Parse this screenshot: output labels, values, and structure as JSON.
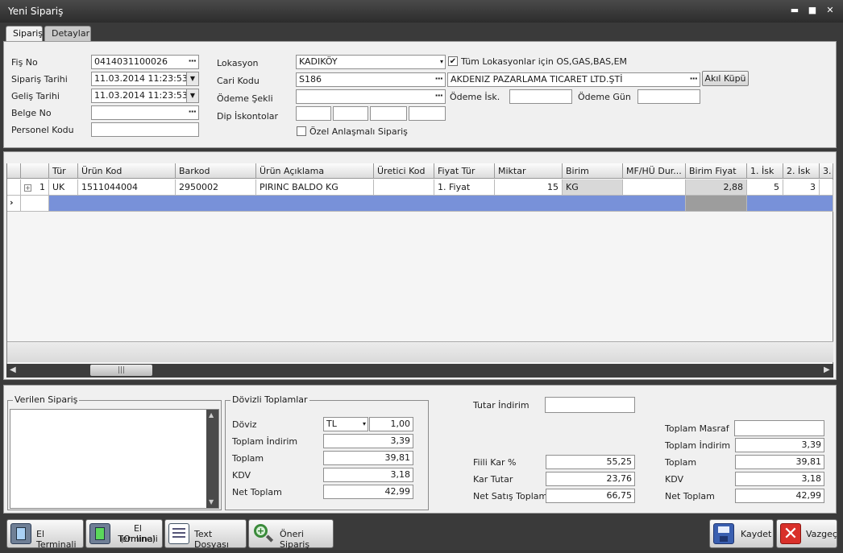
{
  "window": {
    "title": "Yeni Sipariş",
    "min": "▬",
    "max": "■",
    "close": "✕"
  },
  "tabs": [
    {
      "label": "Sipariş"
    },
    {
      "label": "Detaylar"
    }
  ],
  "form": {
    "fis_no_label": "Fiş No",
    "fis_no": "0414031100026",
    "siparis_tarihi_label": "Sipariş Tarihi",
    "siparis_tarihi": "11.03.2014 11:23:53",
    "gelis_tarihi_label": "Geliş Tarihi",
    "gelis_tarihi": "11.03.2014 11:23:53",
    "belge_no_label": "Belge No",
    "belge_no": "",
    "personel_kodu_label": "Personel Kodu",
    "personel_kodu": "",
    "lokasyon_label": "Lokasyon",
    "lokasyon": "KADIKÖY",
    "tum_lokasyon_label": "Tüm Lokasyonlar için OS,GAS,BAS,EM",
    "tum_lokasyon_checked": "✔",
    "cari_kodu_label": "Cari Kodu",
    "cari_kodu": "S186",
    "cari_adi": "AKDENIZ PAZARLAMA TICARET LTD.ŞTİ",
    "akil_kupu": "Akıl Küpü",
    "odeme_sekli_label": "Ödeme Şekli",
    "odeme_sekli": "",
    "odeme_isk_label": "Ödeme İsk.",
    "odeme_gun_label": "Ödeme Gün",
    "dip_iskontolar_label": "Dip İskontolar",
    "ozel_anlasma_label": "Özel Anlaşmalı Sipariş"
  },
  "grid": {
    "columns": [
      "Tür",
      "Ürün Kod",
      "Barkod",
      "Ürün Açıklama",
      "Üretici Kod",
      "Fiyat Tür",
      "Miktar",
      "Birim",
      "MF/HÜ Dur...",
      "Birim Fiyat",
      "1. İsk",
      "2. İsk",
      "3."
    ],
    "rows": [
      {
        "no": "1",
        "tur": "UK",
        "urun_kod": "1511044004",
        "barkod": "2950002",
        "aciklama": "PIRINC BALDO KG",
        "uretici": "",
        "fiyat_tur": "1. Fiyat",
        "miktar": "15",
        "birim": "KG",
        "mf": "",
        "birim_fiyat": "2,88",
        "isk1": "5",
        "isk2": "3"
      }
    ],
    "new_row_marker": "›"
  },
  "verilen": {
    "title": "Verilen Sipariş"
  },
  "dovizli": {
    "title": "Dövizli Toplamlar",
    "doviz_label": "Döviz",
    "doviz": "TL",
    "kur": "1,00",
    "toplam_indirim_label": "Toplam İndirim",
    "toplam_indirim": "3,39",
    "toplam_label": "Toplam",
    "toplam": "39,81",
    "kdv_label": "KDV",
    "kdv": "3,18",
    "net_toplam_label": "Net Toplam",
    "net_toplam": "42,99"
  },
  "mid": {
    "tutar_indirim_label": "Tutar İndirim",
    "tutar_indirim": "",
    "fiili_kar_label": "Fiili Kar %",
    "fiili_kar": "55,25",
    "kar_tutar_label": "Kar Tutar",
    "kar_tutar": "23,76",
    "net_satis_label": "Net Satış Toplam",
    "net_satis": "66,75"
  },
  "right": {
    "toplam_masraf_label": "Toplam Masraf",
    "toplam_masraf": "",
    "toplam_indirim_label": "Toplam İndirim",
    "toplam_indirim": "3,39",
    "toplam_label": "Toplam",
    "toplam": "39,81",
    "kdv_label": "KDV",
    "kdv": "3,18",
    "net_toplam_label": "Net Toplam",
    "net_toplam": "42,99"
  },
  "toolbar": {
    "el_terminali": "El Terminali",
    "el_terminali_online_1": "El Terminali",
    "el_terminali_online_2": "(Online)",
    "text_dosyasi": "Text Dosyası",
    "oneri_siparis": "Öneri Sipariş",
    "kaydet": "Kaydet",
    "vazgec": "Vazgeç"
  }
}
